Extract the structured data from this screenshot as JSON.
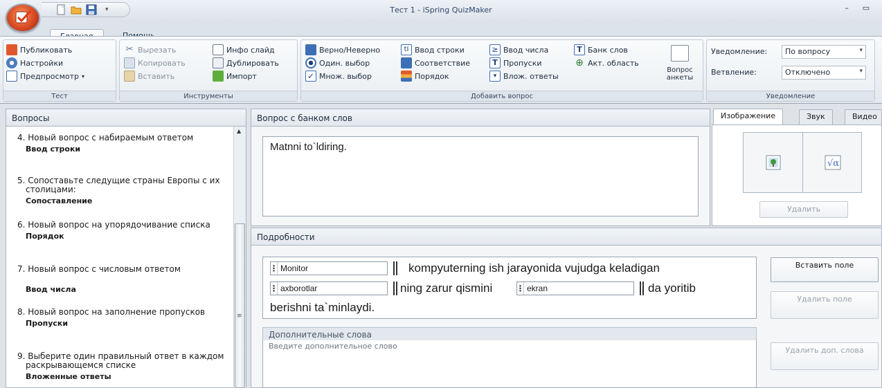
{
  "window": {
    "title": "Тест 1 - iSpring QuizMaker"
  },
  "tabs": [
    {
      "label": "Главная"
    },
    {
      "label": "Помощь"
    }
  ],
  "ribbon": {
    "test": {
      "label": "Тест",
      "publish": "Публиковать",
      "settings": "Настройки",
      "preview": "Предпросмотр"
    },
    "tools": {
      "label": "Инструменты",
      "cut": "Вырезать",
      "copy": "Копировать",
      "paste": "Вставить",
      "info_slide": "Инфо слайд",
      "duplicate": "Дублировать",
      "import": "Импорт"
    },
    "add": {
      "label": "Добавить вопрос",
      "true_false": "Верно/Неверно",
      "single": "Один. выбор",
      "multiple": "Множ. выбор",
      "type_in": "Ввод строки",
      "matching": "Соответствие",
      "sequence": "Порядок",
      "numeric": "Ввод числа",
      "fill_blanks": "Пропуски",
      "nested": "Влож. ответы",
      "word_bank": "Банк слов",
      "hotspot": "Акт. область",
      "survey": "Вопрос анкеты"
    },
    "notify": {
      "label": "Уведомление",
      "feedback_label": "Уведомление:",
      "feedback_value": "По вопросу",
      "branching_label": "Ветвление:",
      "branching_value": "Отключено"
    }
  },
  "questions_panel": {
    "title": "Вопросы",
    "items": [
      {
        "text": "4. Новый вопрос с набираемым ответом",
        "type": "Ввод строки"
      },
      {
        "text": "5. Сопоставьте следущие страны Европы с их столицами:",
        "type": "Сопоставление"
      },
      {
        "text": "6. Новый вопрос на упорядочивание списка",
        "type": "Порядок"
      },
      {
        "text": "7. Новый вопрос с числовым ответом",
        "type": "Ввод числа"
      },
      {
        "text": "8. Новый вопрос на заполнение пропусков",
        "type": "Пропуски"
      },
      {
        "text": "9. Выберите один правильный ответ в каждом раскрывающемся списке",
        "type": "Вложенные ответы"
      }
    ]
  },
  "question": {
    "header": "Вопрос с банком слов",
    "text": "Matnni to`ldiring."
  },
  "media": {
    "tabs": [
      "Изображение",
      "Звук",
      "Видео"
    ],
    "delete": "Удалить"
  },
  "details": {
    "header": "Подробности",
    "fields": [
      "Monitor",
      "axborotlar",
      "ekran"
    ],
    "text1": "kompyuterning ish jarayonida vujudga keladigan",
    "text2": "ning zarur qismini",
    "text3": "da yoritib",
    "text4": "berishni ta`minlaydi.",
    "extra_header": "Дополнительные слова",
    "extra_placeholder": "Введите дополнительное слово",
    "insert_field": "Вставить поле",
    "delete_field": "Удалить поле",
    "delete_extra": "Удалить доп. слова"
  }
}
